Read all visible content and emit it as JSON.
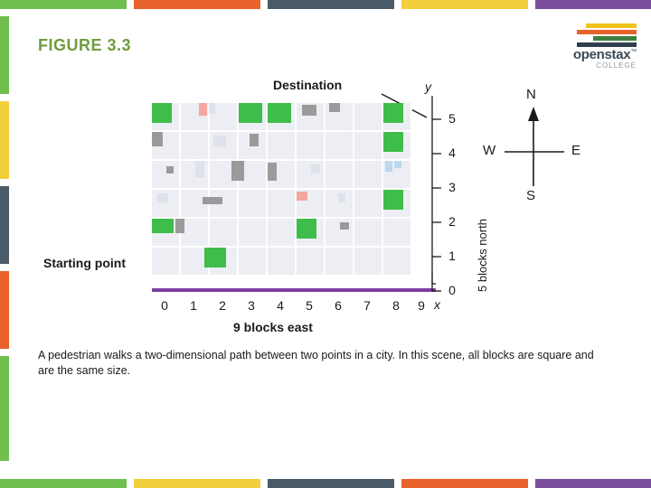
{
  "header": {
    "figure_label": "FIGURE 3.3",
    "logo": {
      "wordmark": "openstax",
      "trademark": "™",
      "subtitle": "COLLEGE",
      "bar_colors": [
        "#f0c419",
        "#e8632c",
        "#3f7f3f",
        "#2f3e4d"
      ]
    },
    "title_color": "#6f9c3f"
  },
  "top_bar_colors": [
    "#6fbf4f",
    "#ffffff",
    "#e8622c",
    "#ffffff",
    "#4a5a66",
    "#ffffff",
    "#f3cf3d",
    "#ffffff",
    "#7b4f9d"
  ],
  "bottom_bar_colors": [
    "#6fbf4f",
    "#ffffff",
    "#f3cf3d",
    "#ffffff",
    "#4a5a66",
    "#ffffff",
    "#e8622c",
    "#ffffff",
    "#7b4f9d"
  ],
  "left_strip_colors": [
    "#6fbf4f",
    "#f3cf3d",
    "#4a5a66",
    "#e8622c",
    "#6fbf4f"
  ],
  "figure": {
    "destination_label": "Destination",
    "starting_point_label": "Starting point",
    "x_axis_caption": "9 blocks east",
    "y_axis_caption": "5 blocks north",
    "x_axis_letter": "x",
    "y_axis_letter": "y",
    "x_ticks": [
      "0",
      "1",
      "2",
      "3",
      "4",
      "5",
      "6",
      "7",
      "8",
      "9"
    ],
    "y_ticks": [
      "0",
      "1",
      "2",
      "3",
      "4",
      "5"
    ],
    "path_color": "#7b3fa0",
    "block_color": "#eceef3",
    "building_green": "#3fbd4a",
    "building_gray": "#9a9a9a",
    "building_light": "#dfe2ea",
    "building_pink": "#f4a6a0",
    "building_blue": "#bcd8ef"
  },
  "compass": {
    "north": "N",
    "south": "S",
    "east": "E",
    "west": "W"
  },
  "caption": {
    "text": "A pedestrian walks a two-dimensional path between two points in a city. In this scene, all blocks are square and are the same size."
  },
  "chart_data": {
    "type": "diagram",
    "title": "FIGURE 3.3",
    "xlabel": "9 blocks east",
    "ylabel": "5 blocks north",
    "xlim": [
      0,
      9
    ],
    "ylim": [
      0,
      5
    ],
    "path": [
      [
        0,
        0
      ],
      [
        9,
        0
      ],
      [
        9,
        5
      ]
    ],
    "markers": [
      {
        "label": "Starting point",
        "x": 0,
        "y": 0
      },
      {
        "label": "Destination",
        "x": 9,
        "y": 5
      }
    ]
  }
}
